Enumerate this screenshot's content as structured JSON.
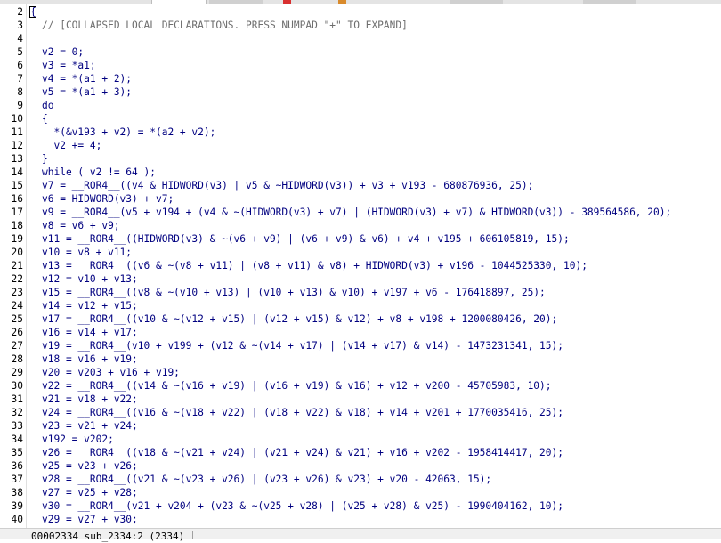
{
  "colors": {
    "code_text": "#000080",
    "comment_text": "#6d6d6d",
    "line_number": "#000000",
    "background": "#ffffff",
    "tab_red_marker": "#d82f2f",
    "tab_orange_marker": "#d98a2b"
  },
  "editor": {
    "caret_line_text": "{",
    "lines": [
      {
        "num": "2",
        "text": "{"
      },
      {
        "num": "3",
        "text": "// [COLLAPSED LOCAL DECLARATIONS. PRESS NUMPAD \"+\" TO EXPAND]",
        "comment": true
      },
      {
        "num": "4",
        "text": ""
      },
      {
        "num": "5",
        "text": "v2 = 0;"
      },
      {
        "num": "6",
        "text": "v3 = *a1;"
      },
      {
        "num": "7",
        "text": "v4 = *(a1 + 2);"
      },
      {
        "num": "8",
        "text": "v5 = *(a1 + 3);"
      },
      {
        "num": "9",
        "text": "do"
      },
      {
        "num": "10",
        "text": "{"
      },
      {
        "num": "11",
        "text": "  *(&v193 + v2) = *(a2 + v2);"
      },
      {
        "num": "12",
        "text": "  v2 += 4;"
      },
      {
        "num": "13",
        "text": "}"
      },
      {
        "num": "14",
        "text": "while ( v2 != 64 );"
      },
      {
        "num": "15",
        "text": "v7 = __ROR4__((v4 & HIDWORD(v3) | v5 & ~HIDWORD(v3)) + v3 + v193 - 680876936, 25);"
      },
      {
        "num": "16",
        "text": "v6 = HIDWORD(v3) + v7;"
      },
      {
        "num": "17",
        "text": "v9 = __ROR4__(v5 + v194 + (v4 & ~(HIDWORD(v3) + v7) | (HIDWORD(v3) + v7) & HIDWORD(v3)) - 389564586, 20);"
      },
      {
        "num": "18",
        "text": "v8 = v6 + v9;"
      },
      {
        "num": "19",
        "text": "v11 = __ROR4__((HIDWORD(v3) & ~(v6 + v9) | (v6 + v9) & v6) + v4 + v195 + 606105819, 15);"
      },
      {
        "num": "20",
        "text": "v10 = v8 + v11;"
      },
      {
        "num": "21",
        "text": "v13 = __ROR4__((v6 & ~(v8 + v11) | (v8 + v11) & v8) + HIDWORD(v3) + v196 - 1044525330, 10);"
      },
      {
        "num": "22",
        "text": "v12 = v10 + v13;"
      },
      {
        "num": "23",
        "text": "v15 = __ROR4__((v8 & ~(v10 + v13) | (v10 + v13) & v10) + v197 + v6 - 176418897, 25);"
      },
      {
        "num": "24",
        "text": "v14 = v12 + v15;"
      },
      {
        "num": "25",
        "text": "v17 = __ROR4__((v10 & ~(v12 + v15) | (v12 + v15) & v12) + v8 + v198 + 1200080426, 20);"
      },
      {
        "num": "26",
        "text": "v16 = v14 + v17;"
      },
      {
        "num": "27",
        "text": "v19 = __ROR4__(v10 + v199 + (v12 & ~(v14 + v17) | (v14 + v17) & v14) - 1473231341, 15);"
      },
      {
        "num": "28",
        "text": "v18 = v16 + v19;"
      },
      {
        "num": "29",
        "text": "v20 = v203 + v16 + v19;"
      },
      {
        "num": "30",
        "text": "v22 = __ROR4__((v14 & ~(v16 + v19) | (v16 + v19) & v16) + v12 + v200 - 45705983, 10);"
      },
      {
        "num": "31",
        "text": "v21 = v18 + v22;"
      },
      {
        "num": "32",
        "text": "v24 = __ROR4__((v16 & ~(v18 + v22) | (v18 + v22) & v18) + v14 + v201 + 1770035416, 25);"
      },
      {
        "num": "33",
        "text": "v23 = v21 + v24;"
      },
      {
        "num": "34",
        "text": "v192 = v202;"
      },
      {
        "num": "35",
        "text": "v26 = __ROR4__((v18 & ~(v21 + v24) | (v21 + v24) & v21) + v16 + v202 - 1958414417, 20);"
      },
      {
        "num": "36",
        "text": "v25 = v23 + v26;"
      },
      {
        "num": "37",
        "text": "v28 = __ROR4__((v21 & ~(v23 + v26) | (v23 + v26) & v23) + v20 - 42063, 15);"
      },
      {
        "num": "38",
        "text": "v27 = v25 + v28;"
      },
      {
        "num": "39",
        "text": "v30 = __ROR4__(v21 + v204 + (v23 & ~(v25 + v28) | (v25 + v28) & v25) - 1990404162, 10);"
      },
      {
        "num": "40",
        "text": "v29 = v27 + v30;"
      }
    ]
  },
  "status": {
    "text": "00002334 sub_2334:2 (2334)"
  }
}
